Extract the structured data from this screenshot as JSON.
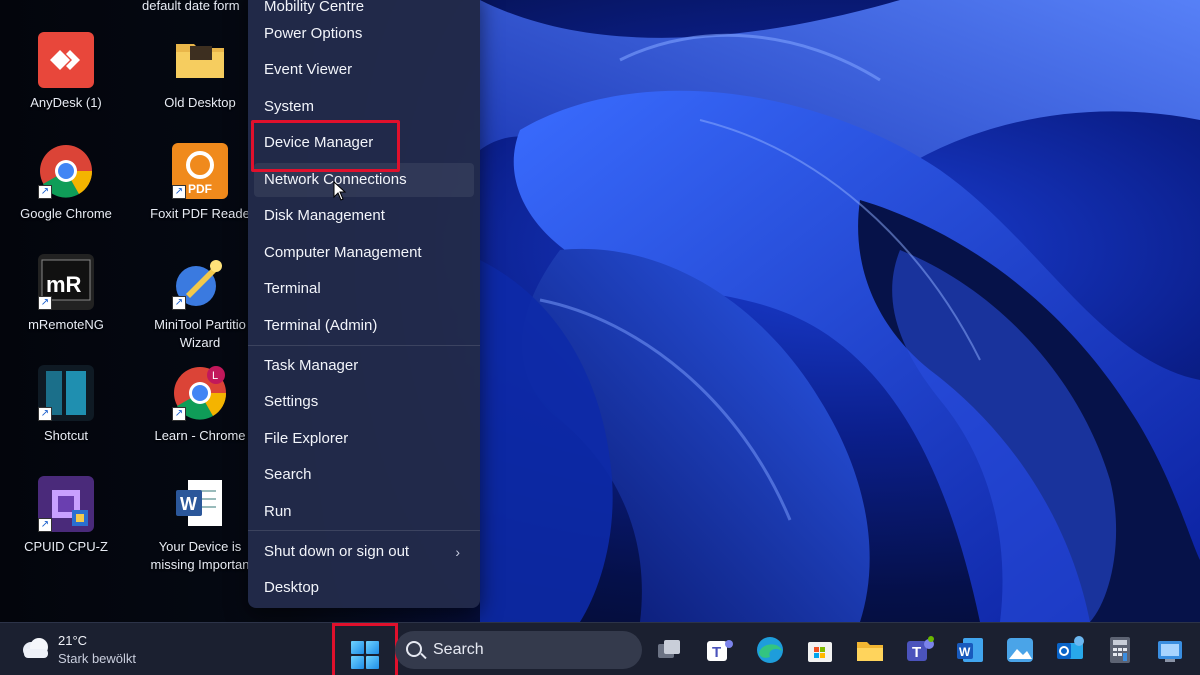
{
  "desktop": {
    "cut_label": "default date form",
    "icons": [
      {
        "label": "AnyDesk (1)"
      },
      {
        "label": "Old Desktop"
      },
      {
        "label": "Google Chrome"
      },
      {
        "label": "Foxit PDF Reade"
      },
      {
        "label": "mRemoteNG"
      },
      {
        "label": "MiniTool Partitio",
        "label2": "Wizard"
      },
      {
        "label": "Shotcut"
      },
      {
        "label": "Learn - Chrome"
      },
      {
        "label": "CPUID CPU-Z"
      },
      {
        "label": "Your Device is",
        "label2": "missing Importan"
      }
    ]
  },
  "context_menu": {
    "items": [
      {
        "label": "Mobility Centre"
      },
      {
        "label": "Power Options"
      },
      {
        "label": "Event Viewer"
      },
      {
        "label": "System"
      },
      {
        "label": "Device Manager",
        "highlighted": true
      },
      {
        "label": "Network Connections"
      },
      {
        "label": "Disk Management"
      },
      {
        "label": "Computer Management"
      },
      {
        "label": "Terminal"
      },
      {
        "label": "Terminal (Admin)"
      },
      {
        "label": "Task Manager"
      },
      {
        "label": "Settings"
      },
      {
        "label": "File Explorer"
      },
      {
        "label": "Search"
      },
      {
        "label": "Run"
      },
      {
        "label": "Shut down or sign out",
        "arrow": "›"
      },
      {
        "label": "Desktop"
      }
    ]
  },
  "taskbar": {
    "weather": {
      "temp": "21°C",
      "condition": "Stark bewölkt"
    },
    "search": {
      "placeholder": "Search"
    },
    "apps": [
      "task-view",
      "teams",
      "edge",
      "store",
      "file-explorer",
      "teams-work",
      "word",
      "photos",
      "outlook",
      "calculator",
      "control-panel"
    ]
  },
  "colors": {
    "highlight": "#e0102c",
    "menu_bg": "#222a4a",
    "taskbar_bg": "#1b2030"
  }
}
